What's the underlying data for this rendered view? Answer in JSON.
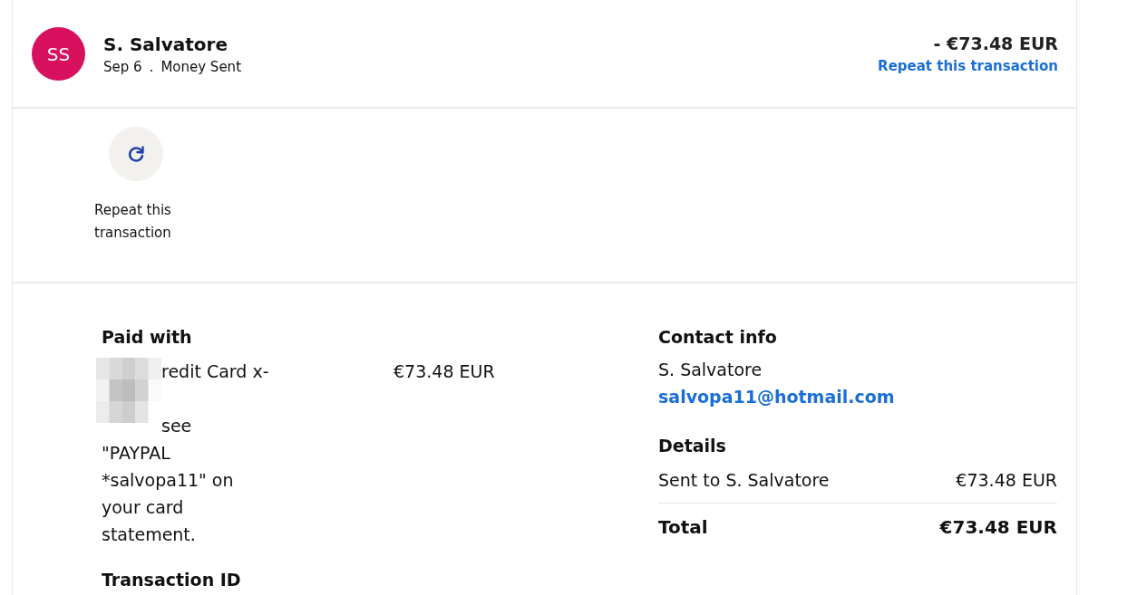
{
  "header": {
    "avatar_initials": "SS",
    "name": "S. Salvatore",
    "date": "Sep 6",
    "separator": ".",
    "type": "Money Sent",
    "amount": "- €73.48 EUR",
    "repeat_link": "Repeat this transaction"
  },
  "actions": [
    {
      "label": "Repeat this transaction"
    }
  ],
  "paid_with": {
    "title": "Paid with",
    "method": "redit Card x-",
    "amount": "€73.48 EUR",
    "note_start": "see",
    "note": "\"PAYPAL *salvopa11\" on your card statement."
  },
  "transaction_id": {
    "title": "Transaction ID"
  },
  "contact": {
    "title": "Contact info",
    "name": "S. Salvatore",
    "email": "salvopa11@hotmail.com"
  },
  "details": {
    "title": "Details",
    "rows": [
      {
        "label": "Sent to S. Salvatore",
        "amount": "€73.48 EUR"
      }
    ],
    "total_label": "Total",
    "total_amount": "€73.48 EUR"
  }
}
